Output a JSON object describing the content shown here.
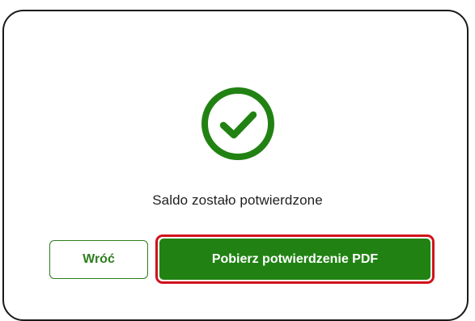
{
  "dialog": {
    "status_icon": "check-circle-icon",
    "message": "Saldo zostało potwierdzone",
    "back_button_label": "Wróć",
    "download_button_label": "Pobierz potwierdzenie PDF"
  },
  "colors": {
    "accent_green": "#218213",
    "outline_green": "#2e7d1f",
    "highlight_red": "#d0121b",
    "text_dark": "#1f1f1f"
  }
}
